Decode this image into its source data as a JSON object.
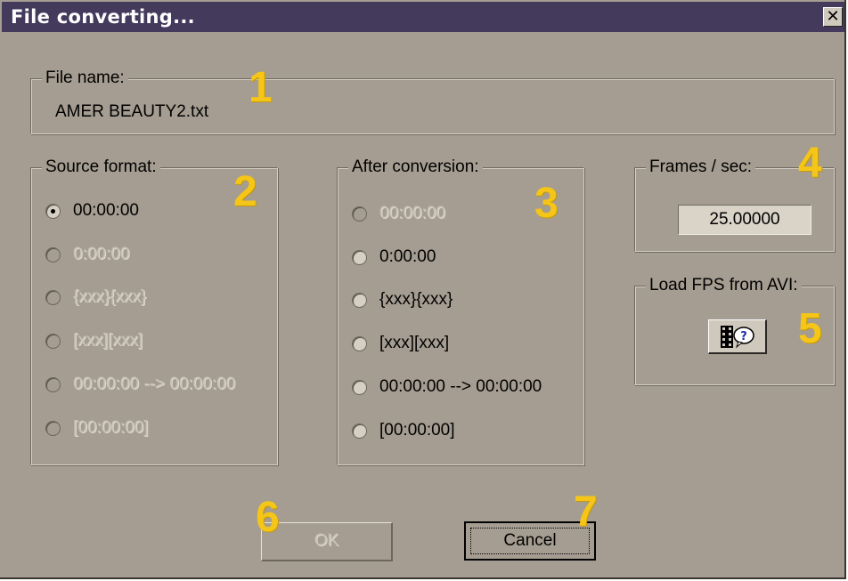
{
  "window": {
    "title": "File converting...",
    "close_glyph": "✕"
  },
  "file_group": {
    "legend": "File name:",
    "value": "AMER BEAUTY2.txt"
  },
  "source_group": {
    "legend": "Source format:",
    "options": [
      {
        "label": "00:00:00",
        "checked": true,
        "enabled": true
      },
      {
        "label": "0:00:00",
        "checked": false,
        "enabled": false
      },
      {
        "label": "{xxx}{xxx}",
        "checked": false,
        "enabled": false
      },
      {
        "label": "[xxx][xxx]",
        "checked": false,
        "enabled": false
      },
      {
        "label": "00:00:00 --> 00:00:00",
        "checked": false,
        "enabled": false
      },
      {
        "label": "[00:00:00]",
        "checked": false,
        "enabled": false
      }
    ]
  },
  "after_group": {
    "legend": "After conversion:",
    "options": [
      {
        "label": "00:00:00",
        "checked": false,
        "enabled": false
      },
      {
        "label": "0:00:00",
        "checked": false,
        "enabled": true
      },
      {
        "label": "{xxx}{xxx}",
        "checked": false,
        "enabled": true
      },
      {
        "label": "[xxx][xxx]",
        "checked": false,
        "enabled": true
      },
      {
        "label": "00:00:00 --> 00:00:00",
        "checked": false,
        "enabled": true
      },
      {
        "label": "[00:00:00]",
        "checked": false,
        "enabled": true
      }
    ]
  },
  "fps_group": {
    "legend": "Frames / sec:",
    "value": "25.00000"
  },
  "avi_group": {
    "legend": "Load FPS from AVI:",
    "icon": "film-question-icon"
  },
  "buttons": {
    "ok": "OK",
    "cancel": "Cancel"
  },
  "markers": [
    "1",
    "2",
    "3",
    "4",
    "5",
    "6",
    "7"
  ],
  "colors": {
    "titlebar": "#433a5c",
    "dialog_bg": "#a59d91",
    "marker": "#f5c518"
  }
}
